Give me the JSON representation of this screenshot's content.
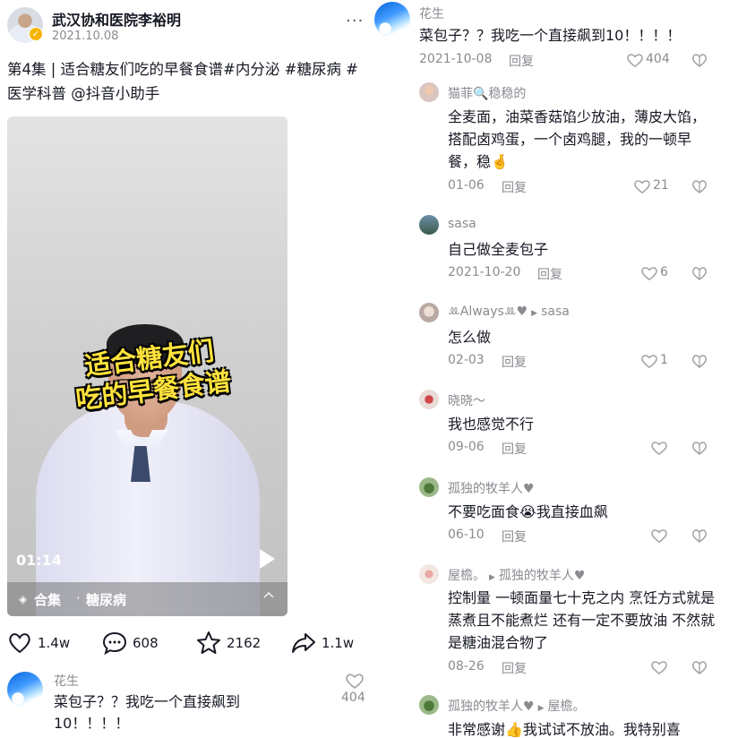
{
  "post": {
    "author": "武汉协和医院李裕明",
    "date": "2021.10.08",
    "more": "···",
    "caption": "第4集 | 适合糖友们吃的早餐食谱#内分泌 #糖尿病 #医学科普 @抖音小助手"
  },
  "video": {
    "title_line1": "适合糖友们",
    "title_line2": "吃的早餐食谱",
    "duration": "01:14",
    "collection_icon": "layers-icon",
    "collection_label": "合集",
    "collection_separator": "·",
    "collection_name": "糖尿病"
  },
  "actions": {
    "likes": "1.4w",
    "comments": "608",
    "favorites": "2162",
    "shares": "1.1w"
  },
  "left_comment": {
    "user": "花生",
    "text": "菜包子？？我吃一个直接飙到10！！！！",
    "likes": "404"
  },
  "comments": [
    {
      "user": "花生",
      "reply_to": "",
      "text": "菜包子？？我吃一个直接飙到10！！！！",
      "date": "2021-10-08",
      "reply_label": "回复",
      "likes": "404"
    },
    {
      "user": "猫菲🔍稳稳的",
      "reply_to": "",
      "text": "全麦面，油菜香菇馅少放油，薄皮大馅，搭配卤鸡蛋，一个卤鸡腿，我的一顿早餐，稳🤞",
      "date": "01-06",
      "reply_label": "回复",
      "likes": "21"
    },
    {
      "user": "sasa",
      "reply_to": "",
      "text": "自己做全麦包子",
      "date": "2021-10-20",
      "reply_label": "回复",
      "likes": "6"
    },
    {
      "user": "ꔛAlwaysꔛ♥",
      "reply_to": "sasa",
      "text": "怎么做",
      "date": "02-03",
      "reply_label": "回复",
      "likes": "1"
    },
    {
      "user": "晓晓～",
      "reply_to": "",
      "text": "我也感觉不行",
      "date": "09-06",
      "reply_label": "回复",
      "likes": ""
    },
    {
      "user": "孤独的牧羊人♥",
      "reply_to": "",
      "text": "不要吃面食😭我直接血飙",
      "date": "06-10",
      "reply_label": "回复",
      "likes": ""
    },
    {
      "user": "屋檐。",
      "reply_to": "孤独的牧羊人♥",
      "text": "控制量 一顿面量七十克之内 烹饪方式就是蒸煮且不能煮烂 还有一定不要放油 不然就是糖油混合物了",
      "date": "08-26",
      "reply_label": "回复",
      "likes": ""
    },
    {
      "user": "孤独的牧羊人♥",
      "reply_to": "屋檐。",
      "text": "非常感谢👍我试试不放油。我特别喜",
      "date": "",
      "reply_label": "",
      "likes": ""
    }
  ],
  "colors": {
    "text": "#161823",
    "muted": "#8a8b91",
    "title_yellow": "#ffe23c",
    "verified": "#f4b400"
  }
}
